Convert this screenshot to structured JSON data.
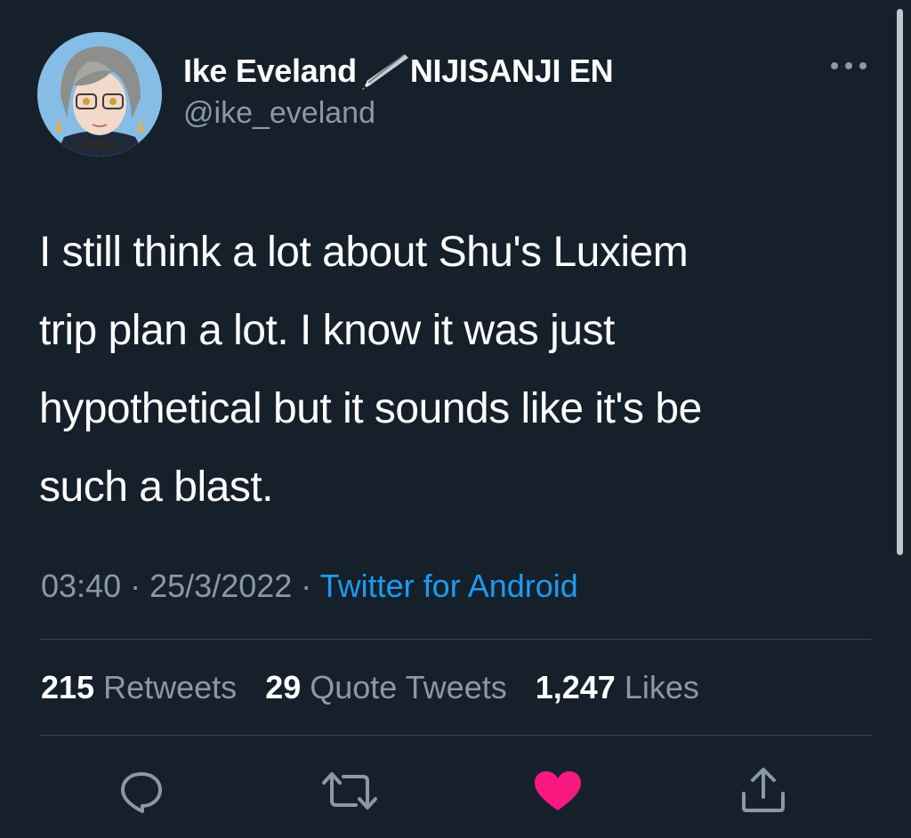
{
  "author": {
    "display_name": "Ike Eveland",
    "badge_icon": "fountain-pen-icon",
    "affiliation": "NIJISANJI EN",
    "handle": "@ike_eveland"
  },
  "tweet": {
    "text": "I still think a lot about Shu's Luxiem\ntrip plan a lot. I know it was just\nhypothetical but it sounds like it's be\nsuch a blast.",
    "time": "03:40",
    "date": "25/3/2022",
    "separator": "·",
    "source": "Twitter for Android"
  },
  "stats": {
    "retweets": {
      "count": "215",
      "label": "Retweets"
    },
    "quotes": {
      "count": "29",
      "label": "Quote Tweets"
    },
    "likes": {
      "count": "1,247",
      "label": "Likes"
    }
  },
  "actions": [
    {
      "name": "reply-icon"
    },
    {
      "name": "retweet-icon"
    },
    {
      "name": "like-icon",
      "state": "liked",
      "color": "#f91880"
    },
    {
      "name": "share-icon"
    }
  ],
  "colors": {
    "background": "#15202b",
    "secondary_text": "#8b98a5",
    "link": "#1d9bf0",
    "like": "#f91880"
  }
}
